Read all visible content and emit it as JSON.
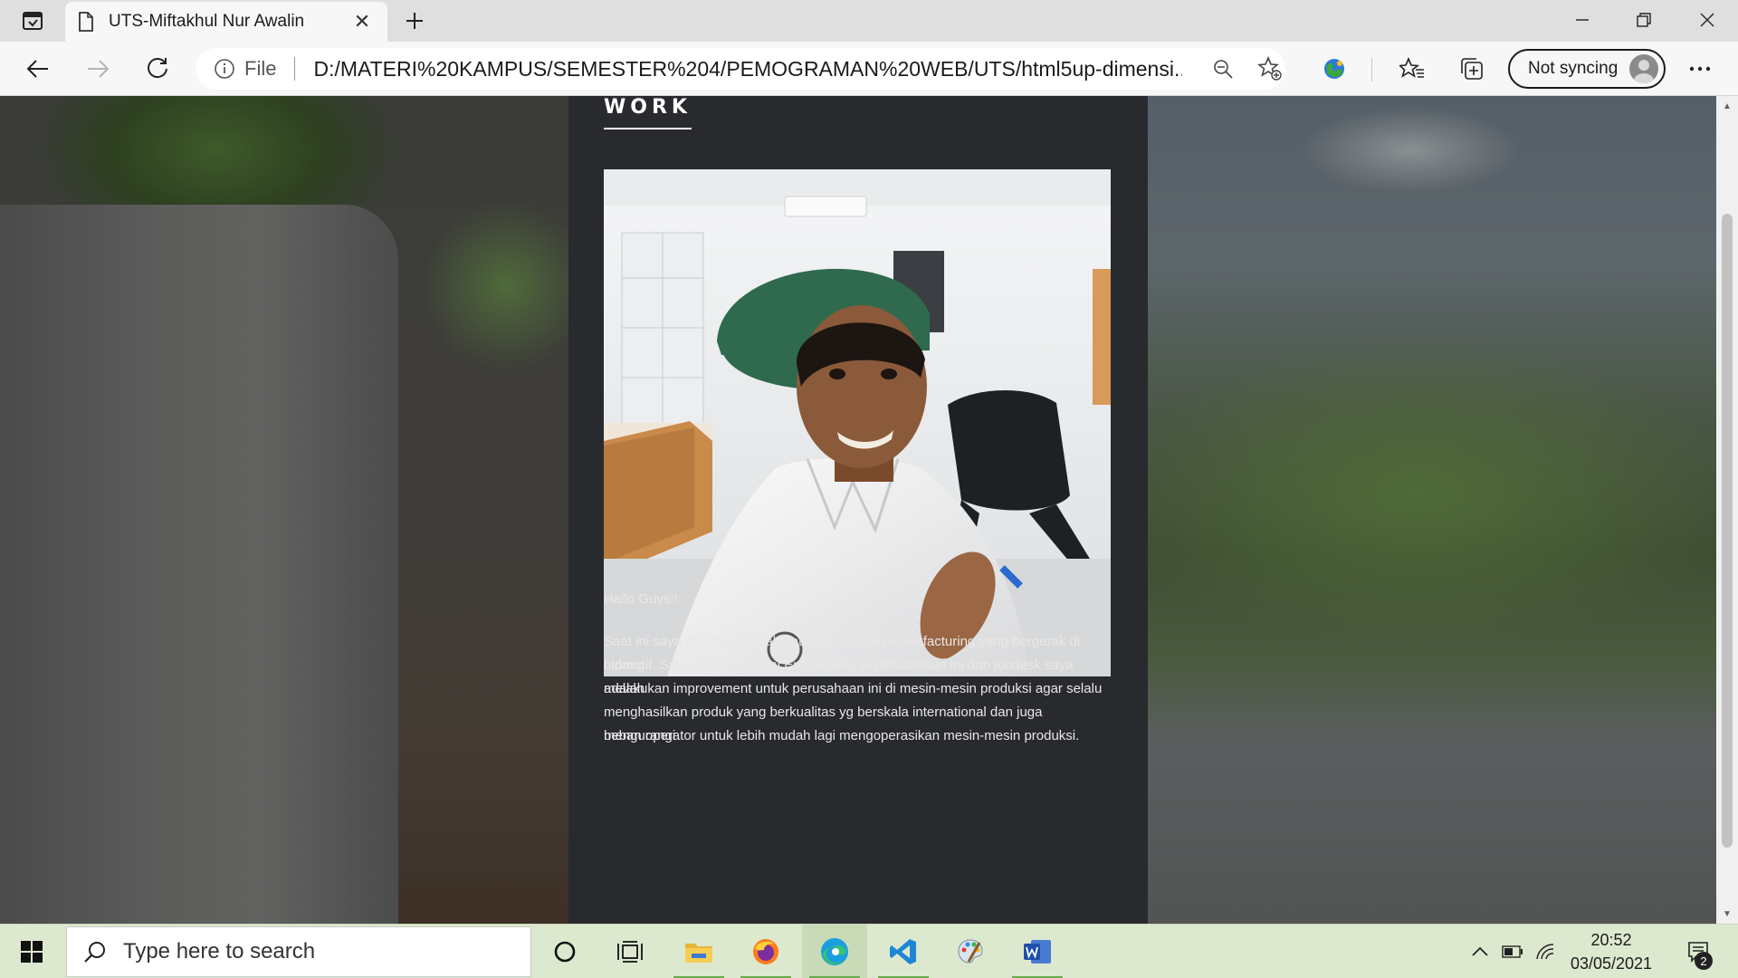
{
  "browser": {
    "tab_title": "UTS-Miftakhul Nur Awalin",
    "address_scheme": "File",
    "address_url": "D:/MATERI%20KAMPUS/SEMESTER%204/PEMOGRAMAN%20WEB/UTS/html5up-dimensi...",
    "sync_label": "Not syncing"
  },
  "page": {
    "section_title": "WORK",
    "greeting": "Hallo Guys!!",
    "body_lines": [
      "Saat ini saya bekerja di salah satu perusahaan manufacturing yang bergerak di bidang",
      "otomotif. Saya di sini sebagai Engineering di perusahaan ini dan jobdesk saya adalah",
      "melakukan improvement untuk perusahaan ini di mesin-mesin produksi agar selalu",
      "menghasilkan produk yang berkualitas yg berskala international dan juga mengurangi",
      "beban operator untuk lebih mudah lagi mengoperasikan mesin-mesin produksi."
    ]
  },
  "taskbar": {
    "search_placeholder": "Type here to search",
    "time": "20:52",
    "date": "03/05/2021",
    "notification_count": "2"
  },
  "colors": {
    "panel_bg": "#282a2e",
    "taskbar_bg": "#dde9ce",
    "chrome_bg": "#f7f7f7"
  }
}
